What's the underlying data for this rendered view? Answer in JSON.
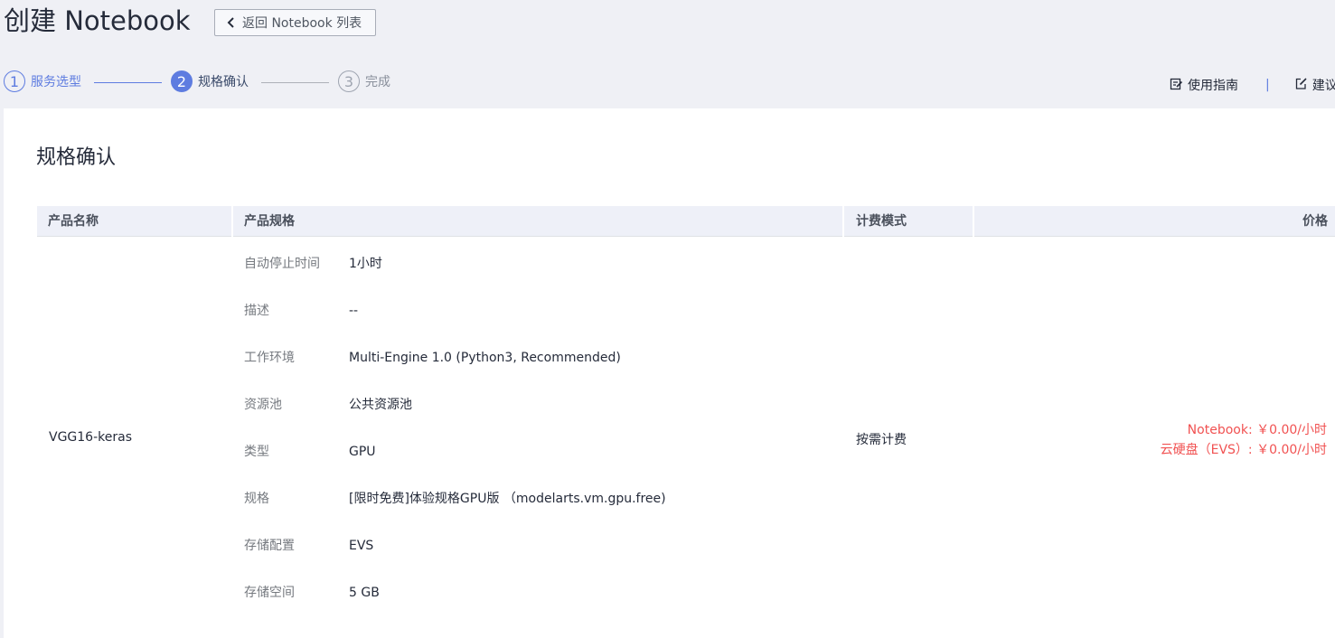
{
  "page": {
    "title": "创建 Notebook",
    "back_label": "返回 Notebook 列表"
  },
  "stepper": {
    "steps": [
      {
        "num": "1",
        "label": "服务选型",
        "state": "done"
      },
      {
        "num": "2",
        "label": "规格确认",
        "state": "active"
      },
      {
        "num": "3",
        "label": "完成",
        "state": "pending"
      }
    ]
  },
  "top_links": {
    "guide": "使用指南",
    "feedback": "建议"
  },
  "section": {
    "title": "规格确认"
  },
  "table": {
    "headers": {
      "product_name": "产品名称",
      "product_spec": "产品规格",
      "billing_mode": "计费模式",
      "price": "价格"
    },
    "row": {
      "product_name": "VGG16-keras",
      "billing_mode": "按需计费",
      "specs": [
        {
          "key": "自动停止时间",
          "value": "1小时"
        },
        {
          "key": "描述",
          "value": "--"
        },
        {
          "key": "工作环境",
          "value": "Multi-Engine 1.0 (Python3, Recommended)"
        },
        {
          "key": "资源池",
          "value": "公共资源池"
        },
        {
          "key": "类型",
          "value": "GPU"
        },
        {
          "key": "规格",
          "value": "[限时免费]体验规格GPU版 （modelarts.vm.gpu.free)"
        },
        {
          "key": "存储配置",
          "value": "EVS"
        },
        {
          "key": "存储空间",
          "value": "5 GB"
        }
      ],
      "prices": [
        "Notebook: ￥0.00/小时",
        "云硬盘（EVS）: ￥0.00/小时"
      ]
    }
  },
  "colors": {
    "accent": "#5e7ce0",
    "price_red": "#f15252",
    "header_bg": "#eef0f8",
    "page_bg": "#eff0f5"
  }
}
